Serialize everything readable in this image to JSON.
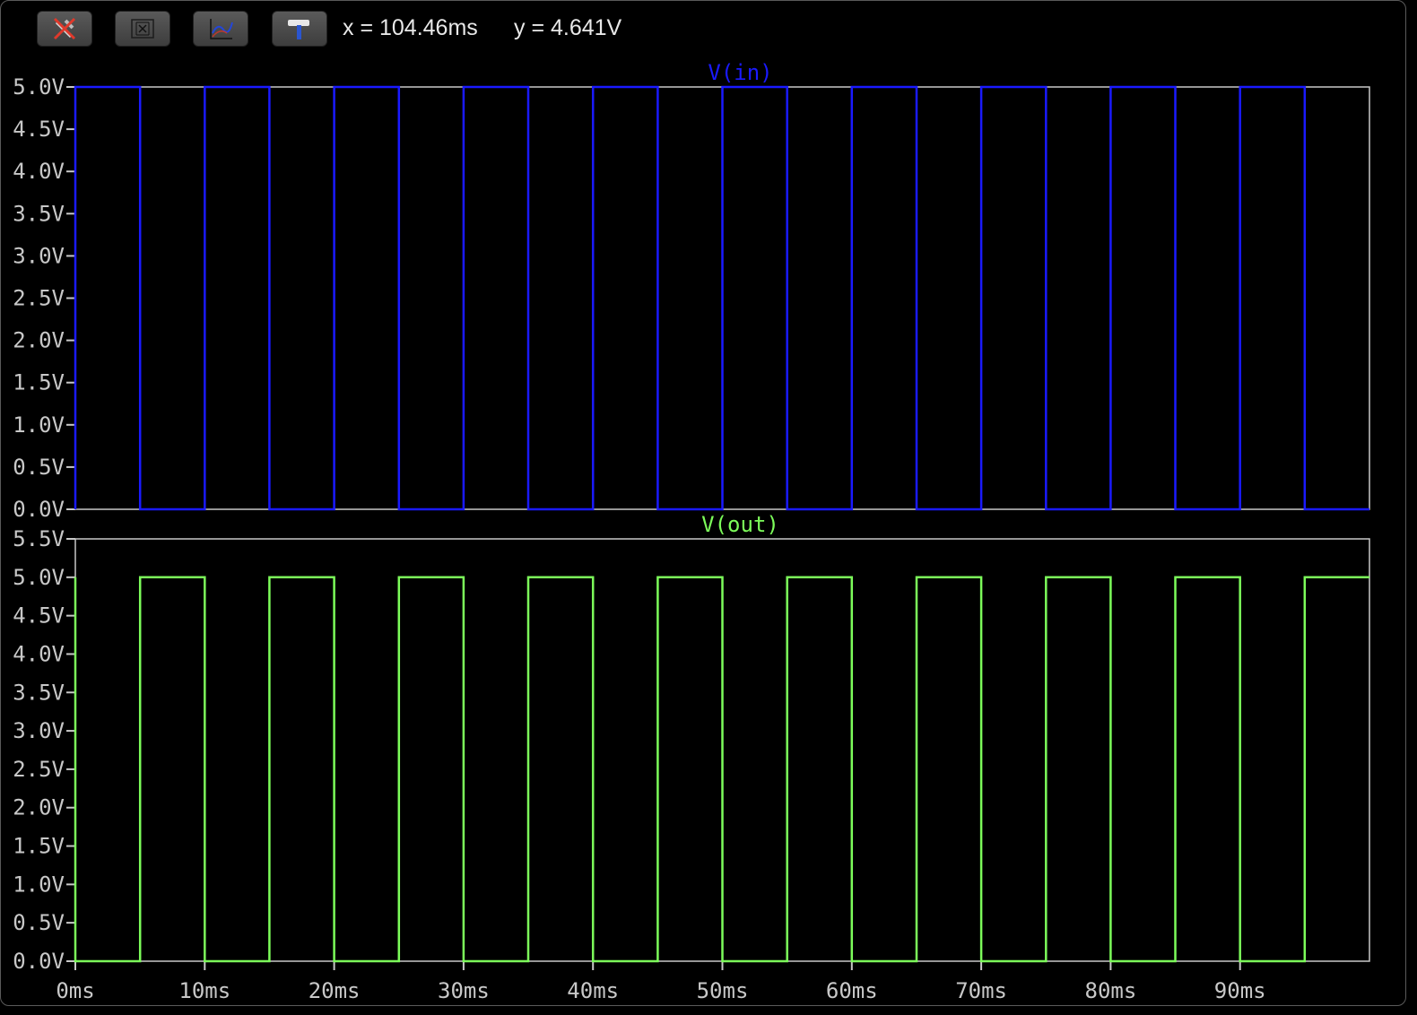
{
  "toolbar": {
    "buttons": [
      {
        "icon": "crossed-probe-icon"
      },
      {
        "icon": "autorange-icon"
      },
      {
        "icon": "plot-settings-icon"
      },
      {
        "icon": "hammer-icon"
      }
    ],
    "cursor_x": "x = 104.46ms",
    "cursor_y": "y = 4.641V"
  },
  "colors": {
    "vin": "#1a1aff",
    "vout": "#7CFC5A",
    "axis": "#c8c8c8",
    "background": "#000000"
  },
  "chart_data": [
    {
      "type": "line",
      "title": "V(in)",
      "series": [
        {
          "name": "V(in)",
          "x": [
            0,
            0,
            5,
            5,
            10,
            10,
            15,
            15,
            20,
            20,
            25,
            25,
            30,
            30,
            35,
            35,
            40,
            40,
            45,
            45,
            50,
            50,
            55,
            55,
            60,
            60,
            65,
            65,
            70,
            70,
            75,
            75,
            80,
            80,
            85,
            85,
            90,
            90,
            95,
            95,
            100
          ],
          "y": [
            0,
            5,
            5,
            0,
            0,
            5,
            5,
            0,
            0,
            5,
            5,
            0,
            0,
            5,
            5,
            0,
            0,
            5,
            5,
            0,
            0,
            5,
            5,
            0,
            0,
            5,
            5,
            0,
            0,
            5,
            5,
            0,
            0,
            5,
            5,
            0,
            0,
            5,
            5,
            0,
            0
          ]
        }
      ],
      "ylim": [
        0,
        5
      ],
      "xlim": [
        0,
        100
      ],
      "yticks": [
        0,
        0.5,
        1.0,
        1.5,
        2.0,
        2.5,
        3.0,
        3.5,
        4.0,
        4.5,
        5.0
      ],
      "ytick_labels": [
        "0.0V",
        "0.5V",
        "1.0V",
        "1.5V",
        "2.0V",
        "2.5V",
        "3.0V",
        "3.5V",
        "4.0V",
        "4.5V",
        "5.0V"
      ],
      "grid": false
    },
    {
      "type": "line",
      "title": "V(out)",
      "series": [
        {
          "name": "V(out)",
          "x": [
            0,
            0,
            5,
            5,
            10,
            10,
            15,
            15,
            20,
            20,
            25,
            25,
            30,
            30,
            35,
            35,
            40,
            40,
            45,
            45,
            50,
            50,
            55,
            55,
            60,
            60,
            65,
            65,
            70,
            70,
            75,
            75,
            80,
            80,
            85,
            85,
            90,
            90,
            95,
            95,
            100
          ],
          "y": [
            5,
            0,
            0,
            5,
            5,
            0,
            0,
            5,
            5,
            0,
            0,
            5,
            5,
            0,
            0,
            5,
            5,
            0,
            0,
            5,
            5,
            0,
            0,
            5,
            5,
            0,
            0,
            5,
            5,
            0,
            0,
            5,
            5,
            0,
            0,
            5,
            5,
            0,
            0,
            5,
            5
          ]
        }
      ],
      "ylim": [
        0,
        5.5
      ],
      "xlim": [
        0,
        100
      ],
      "yticks": [
        0,
        0.5,
        1.0,
        1.5,
        2.0,
        2.5,
        3.0,
        3.5,
        4.0,
        4.5,
        5.0,
        5.5
      ],
      "ytick_labels": [
        "0.0V",
        "0.5V",
        "1.0V",
        "1.5V",
        "2.0V",
        "2.5V",
        "3.0V",
        "3.5V",
        "4.0V",
        "4.5V",
        "5.0V",
        "5.5V"
      ],
      "xticks": [
        0,
        10,
        20,
        30,
        40,
        50,
        60,
        70,
        80,
        90
      ],
      "xtick_labels": [
        "0ms",
        "10ms",
        "20ms",
        "30ms",
        "40ms",
        "50ms",
        "60ms",
        "70ms",
        "80ms",
        "90ms"
      ],
      "grid": false
    }
  ]
}
